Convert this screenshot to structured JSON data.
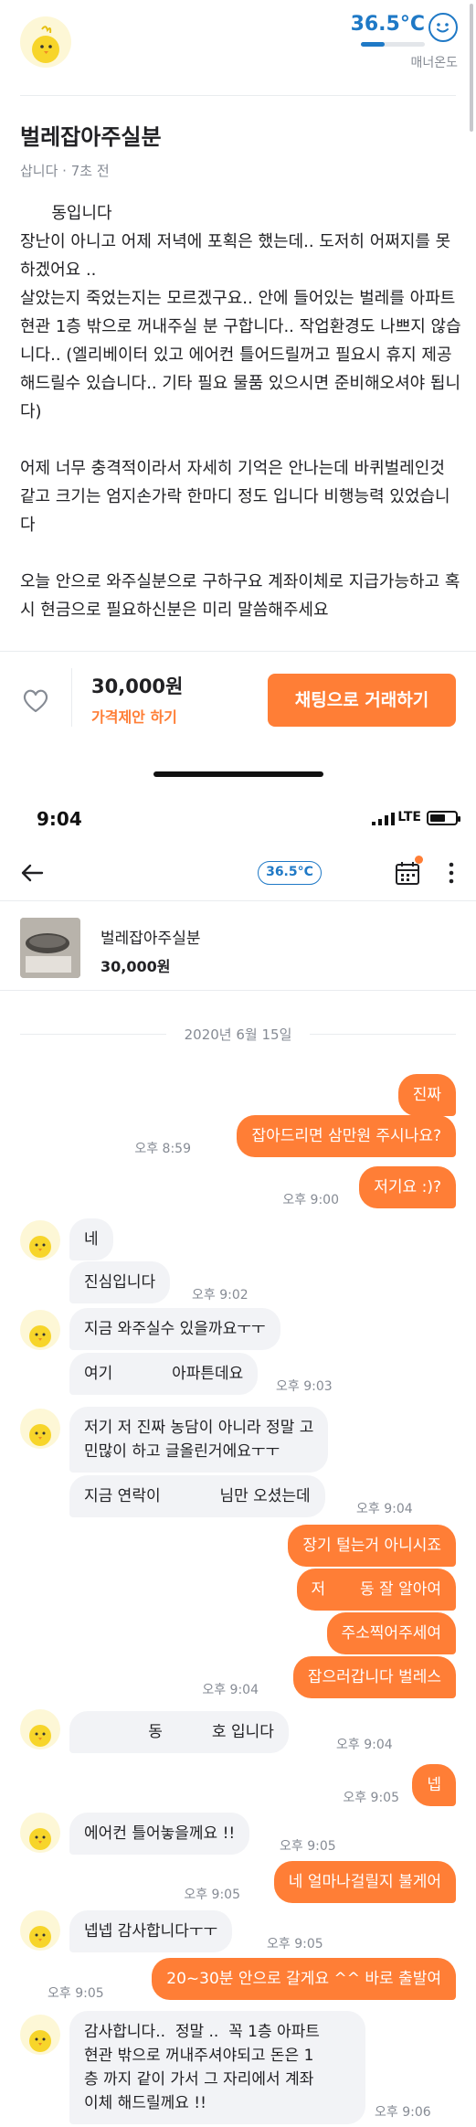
{
  "post": {
    "manner_temperature": "36.5°C",
    "manner_level": 0.365,
    "manner_label": "매너온도",
    "title": "벌레잡아주실분",
    "meta": "삽니다 · 7초 전",
    "body": "      동입니다\n장난이 아니고 어제 저녁에 포획은 했는데.. 도저히 어쩌지를 못하겠어요 ..\n살았는지 죽었는지는 모르겠구요.. 안에 들어있는 벌레를 아파트 현관 1층 밖으로 꺼내주실 분 구합니다.. 작업환경도 나쁘지 않습니다.. (엘리베이터 있고 에어컨 틀어드릴꺼고 필요시 휴지 제공해드릴수 있습니다.. 기타 필요 물품 있으시면 준비해오셔야 됩니다)\n\n어제 너무 충격적이라서 자세히 기억은 안나는데 바퀴벌레인것 같고 크기는 엄지손가락 한마디 정도 입니다 비행능력 있었습니다\n\n오늘 안으로 와주실분으로 구하구요 계좌이체로 지급가능하고 혹시 현금으로 필요하신분은 미리 말씀해주세요",
    "price": "30,000원",
    "price_offer": "가격제안 하기",
    "chat_button": "채팅으로 거래하기"
  },
  "status_bar": {
    "time": "9:04",
    "network": "LTE"
  },
  "chat_header": {
    "temperature": "36.5°C"
  },
  "product": {
    "title": "벌레잡아주실분",
    "price": "30,000원"
  },
  "chat": {
    "date": "2020년 6월 15일",
    "messages": [
      {
        "from": "me",
        "text": "진짜",
        "time": ""
      },
      {
        "from": "me",
        "text": "잡아드리면 삼만원 주시나요?",
        "time": "오후 8:59"
      },
      {
        "from": "me",
        "text": "저기요 :)?",
        "time": "오후 9:00"
      },
      {
        "from": "them",
        "text": "네",
        "time": ""
      },
      {
        "from": "them",
        "text": "진심입니다",
        "time": "오후 9:02"
      },
      {
        "from": "them",
        "text": "지금 와주실수 있을까요ㅜㅜ",
        "time": ""
      },
      {
        "from": "them",
        "text": "여기            아파튼데요",
        "time": "오후 9:03"
      },
      {
        "from": "them",
        "text": "저기 저 진짜 농담이 아니라 정말 고\n민많이 하고 글올린거에요ㅜㅜ",
        "time": ""
      },
      {
        "from": "them",
        "text": "지금 연락이            님만 오셨는데",
        "time": "오후 9:04"
      },
      {
        "from": "me",
        "text": "장기 털는거 아니시죠",
        "time": ""
      },
      {
        "from": "me",
        "text": "저       동 잘 알아여",
        "time": ""
      },
      {
        "from": "me",
        "text": "주소찍어주세여",
        "time": ""
      },
      {
        "from": "me",
        "text": "잡으러갑니다 벌레스",
        "time": "오후 9:04"
      },
      {
        "from": "them",
        "text": "             동          호 입니다",
        "time": "오후 9:04"
      },
      {
        "from": "me",
        "text": "넵",
        "time": "오후 9:05"
      },
      {
        "from": "them",
        "text": "에어컨 틀어놓을께요 !!",
        "time": "오후 9:05"
      },
      {
        "from": "me",
        "text": "네 얼마나걸릴지 불게어",
        "time": "오후 9:05"
      },
      {
        "from": "them",
        "text": "넵넵 감사합니다ㅜㅜ",
        "time": "오후 9:05"
      },
      {
        "from": "me",
        "text": "20~30분 안으로 갈게요 ^^ 바로 출발여",
        "time": "오후 9:05"
      },
      {
        "from": "them",
        "text": "감사합니다..  정말 ..  꼭 1층 아파트\n현관 밖으로 꺼내주셔야되고 돈은 1\n층 까지 같이 가서 그 자리에서 계좌\n이체 해드릴께요 !!",
        "time": "오후 9:06"
      }
    ]
  },
  "colors": {
    "accent": "#ff7e36",
    "manner_blue": "#1f79c6",
    "bubble_gray": "#f2f3f6",
    "meta_gray": "#868b94"
  },
  "icons": [
    "chick-avatar-icon",
    "smiley-icon",
    "heart-icon",
    "back-arrow-icon",
    "calendar-icon",
    "more-vertical-icon",
    "signal-icon",
    "battery-icon"
  ]
}
